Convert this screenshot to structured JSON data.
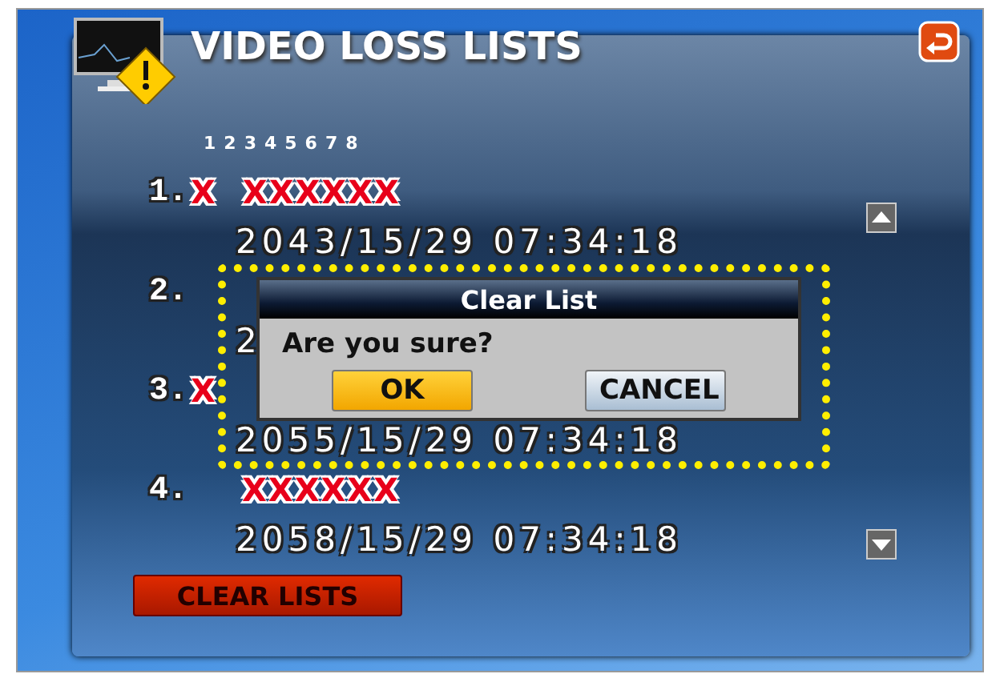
{
  "window": {
    "title": "VIDEO LOSS LISTS"
  },
  "channel_header": [
    "1",
    "2",
    "3",
    "4",
    "5",
    "6",
    "7",
    "8"
  ],
  "entries": [
    {
      "index": "1.",
      "marks": [
        "X",
        "XXXXXX"
      ],
      "time": "2043/15/29 07:34:18"
    },
    {
      "index": "2.",
      "time": "2"
    },
    {
      "index": "3.",
      "marks": [
        "X"
      ],
      "time": "2055/15/29 07:34:18"
    },
    {
      "index": "4.",
      "marks": [
        "XXXXXX"
      ],
      "time": "2058/15/29 07:34:18"
    }
  ],
  "clear_button": {
    "label": "CLEAR LISTS"
  },
  "dialog": {
    "title": "Clear List",
    "message": "Are you sure?",
    "buttons": [
      {
        "label": "OK",
        "selected": true
      },
      {
        "label": "CANCEL",
        "selected": false
      }
    ],
    "highlighted": true
  }
}
